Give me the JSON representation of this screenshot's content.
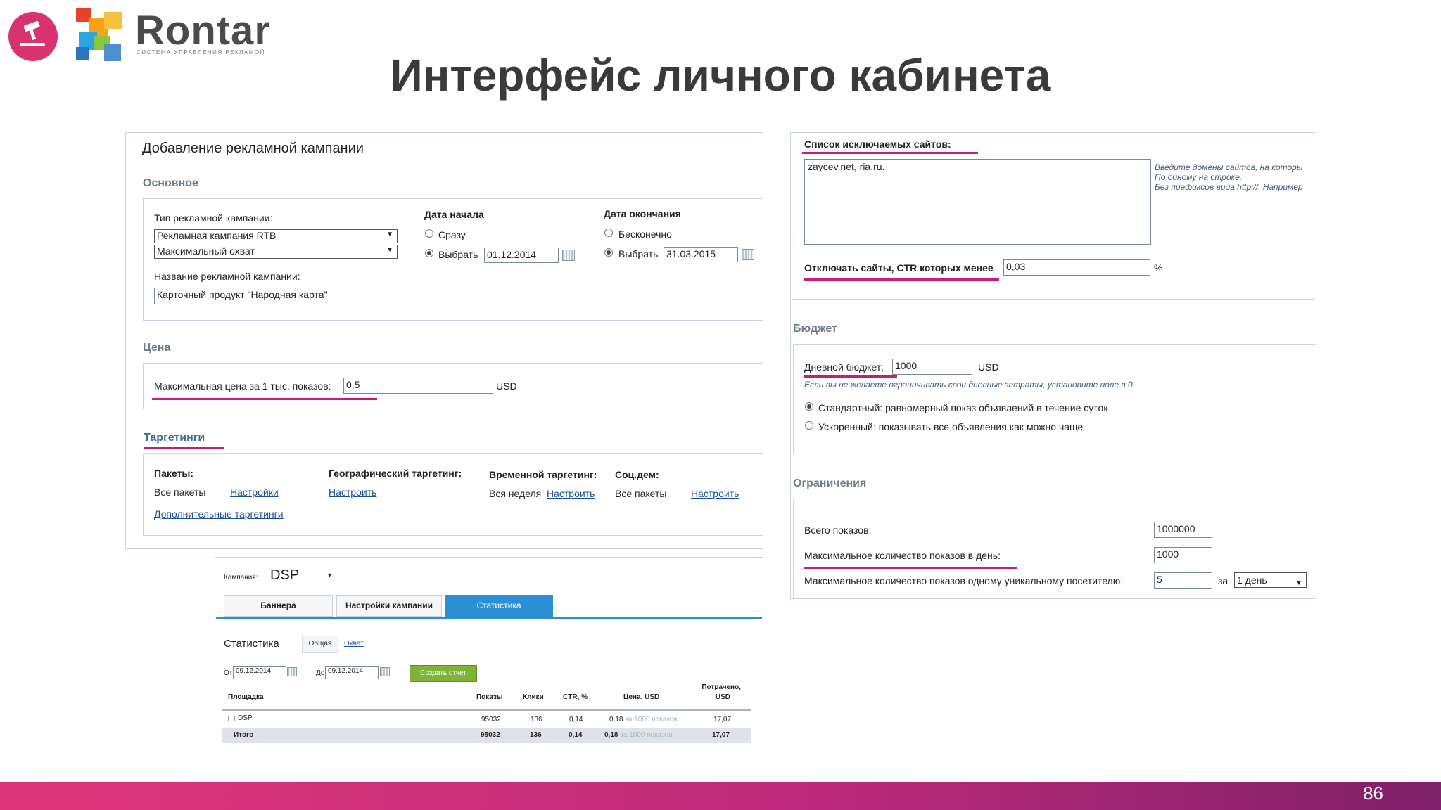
{
  "brand": {
    "name": "Rontar",
    "tagline": "СИСТЕМА УПРАВЛЕНИЯ РЕКЛАМОЙ",
    "accent": "#d8336f"
  },
  "title": "Интерфейс личного кабинета",
  "page_number": "86",
  "campaign_form": {
    "header": "Добавление рекламной кампании",
    "basic": {
      "section": "Основное",
      "type_label": "Тип рекламной кампании:",
      "type_value": "Рекламная кампания RTB",
      "coverage_value": "Максимальный охват",
      "name_label": "Название рекламной кампании:",
      "name_value": "Карточный продукт \"Народная карта\"",
      "start_title": "Дата начала",
      "start_immediate": "Сразу",
      "start_choose": "Выбрать",
      "start_date": "01.12.2014",
      "end_title": "Дата окончания",
      "end_infinite": "Бесконечно",
      "end_choose": "Выбрать",
      "end_date": "31.03.2015"
    },
    "price": {
      "section": "Цена",
      "max_label": "Максимальная цена за 1 тыс. показов:",
      "max_value": "0,5",
      "currency": "USD"
    },
    "targeting": {
      "section": "Таргетинги",
      "packages_title": "Пакеты:",
      "packages_value": "Все пакеты",
      "packages_link": "Настройки",
      "extra_link": "Дополнительные таргетинги",
      "geo_title": "Географический таргетинг:",
      "geo_link": "Настроить",
      "time_title": "Временной таргетинг:",
      "time_value": "Вся неделя",
      "time_link": "Настроить",
      "socdem_title": "Соц.дем:",
      "socdem_value": "Все пакеты",
      "socdem_link": "Настроить"
    }
  },
  "settings_panel": {
    "exclude_title": "Список исключаемых сайтов:",
    "exclude_value": "zaycev.net, ria.ru.",
    "exclude_hint": [
      "Введите домены сайтов, на которы",
      "По одному на строке.",
      "Без префиксов вида http://. Например"
    ],
    "ctr_label": "Отключать сайты, CTR которых менее",
    "ctr_value": "0,03",
    "ctr_unit": "%",
    "budget": {
      "section": "Бюджет",
      "daily_label": "Дневной бюджет:",
      "daily_value": "1000",
      "currency": "USD",
      "hint": "Если вы не желаете ограничивать свои дневные затраты, установите поле в 0.",
      "standard": "Стандартный: равномерный показ объявлений в течение суток",
      "accelerated": "Ускоренный: показывать все объявления как можно чаще"
    },
    "limits": {
      "section": "Ограничения",
      "total_label": "Всего показов:",
      "total_value": "1000000",
      "per_day_label": "Максимальное количество показов в день:",
      "per_day_value": "1000",
      "per_user_label": "Максимальное количество показов одному уникальному посетителю:",
      "per_user_value": "5",
      "per_word": "за",
      "period_value": "1 день"
    }
  },
  "stats_panel": {
    "campaign_label": "Кампания:",
    "campaign_value": "DSP",
    "tabs": [
      "Баннера",
      "Настройки кампании",
      "Статистика"
    ],
    "active_tab": "Статистика",
    "header": "Статистика",
    "view_general": "Общая",
    "view_reach": "Охват",
    "from_label": "От",
    "from_date": "09.12.2014",
    "to_label": "До",
    "to_date": "09.12.2014",
    "report_button": "Создать отчет",
    "columns": [
      "Площадка",
      "Показы",
      "Клики",
      "CTR, %",
      "Цена, USD",
      "Потрачено,",
      "USD"
    ],
    "rows": [
      {
        "site": "DSP",
        "impressions": "95032",
        "clicks": "136",
        "ctr": "0,14",
        "price": "0,18",
        "price_note": "за 1000 показов",
        "spent": "17,07"
      },
      {
        "site": "Итого",
        "impressions": "95032",
        "clicks": "136",
        "ctr": "0,14",
        "price": "0,18",
        "price_note": "за 1000 показов",
        "spent": "17,07"
      }
    ]
  }
}
